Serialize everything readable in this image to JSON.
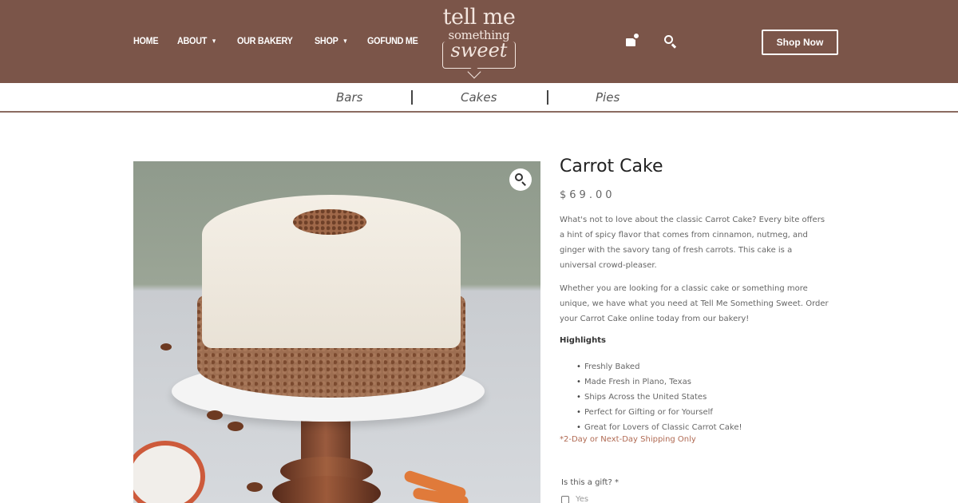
{
  "header": {
    "nav": [
      {
        "label": "HOME",
        "has_dropdown": false
      },
      {
        "label": "ABOUT",
        "has_dropdown": true
      },
      {
        "label": "OUR BAKERY",
        "has_dropdown": false
      },
      {
        "label": "SHOP",
        "has_dropdown": true
      },
      {
        "label": "GOFUND ME",
        "has_dropdown": false
      }
    ],
    "logo": {
      "line1": "tell me",
      "line2": "something",
      "line3": "sweet"
    },
    "cart_icon": "cart-icon",
    "search_icon": "search-icon",
    "shop_now_label": "Shop Now",
    "bg_color": "#7b5549"
  },
  "categories": [
    "Bars",
    "Cakes",
    "Pies"
  ],
  "product": {
    "title": "Carrot Cake",
    "price": "$69.00",
    "description": [
      "What's not to love about the classic Carrot Cake? Every bite offers a hint of spicy flavor that comes from cinnamon, nutmeg, and ginger with the savory tang of fresh carrots. This cake is a universal crowd-pleaser.",
      "Whether you are looking for a classic cake or something more unique, we have what you need at Tell Me Something Sweet. Order your Carrot Cake online today from our bakery!"
    ],
    "highlights_heading": "Highlights",
    "highlights": [
      "Freshly Baked",
      "Made Fresh in Plano, Texas",
      "Ships Across the United States",
      "Perfect for Gifting or for Yourself",
      "Great for Lovers of Classic Carrot Cake!"
    ],
    "shipping_note": "*2-Day or Next-Day Shipping Only",
    "gift_question": "Is this a gift? *",
    "gift_option": "Yes",
    "zoom_icon": "zoom-icon"
  }
}
